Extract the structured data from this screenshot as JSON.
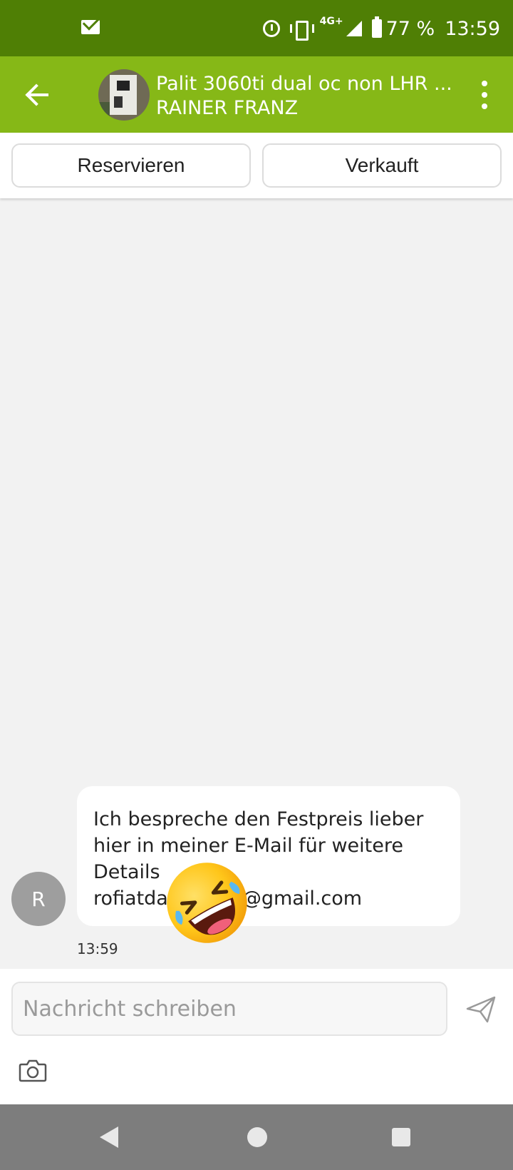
{
  "status_bar": {
    "network": "4G+",
    "battery": "77 %",
    "time": "13:59",
    "icons": [
      "mail-icon",
      "alarm-icon",
      "vibrate-icon",
      "signal-icon",
      "battery-icon"
    ]
  },
  "app_bar": {
    "title": "Palit 3060ti dual oc non LHR ...",
    "subtitle": "RAINER FRANZ",
    "back_icon": "arrow-left-icon",
    "menu_icon": "more-vert-icon",
    "background": "#86b817"
  },
  "actions": {
    "reserve_label": "Reservieren",
    "sold_label": "Verkauft"
  },
  "conversation": {
    "messages": [
      {
        "sender_initial": "R",
        "lines": [
          "Ich bespreche den Festpreis lieber",
          "hier in meiner E-Mail für weitere",
          "Details",
          "rofiatda",
          "@gmail.com"
        ],
        "time": "13:59",
        "emoji": "rolling-on-floor-laughing-emoji"
      }
    ]
  },
  "composer": {
    "placeholder": "Nachricht schreiben",
    "send_icon": "send-icon",
    "camera_icon": "camera-icon"
  },
  "nav_bar": {
    "icons": [
      "nav-back-icon",
      "nav-home-icon",
      "nav-recents-icon"
    ]
  },
  "colors": {
    "status_bar": "#4f7f05",
    "app_bar": "#86b817",
    "chat_background": "#f2f2f2"
  }
}
